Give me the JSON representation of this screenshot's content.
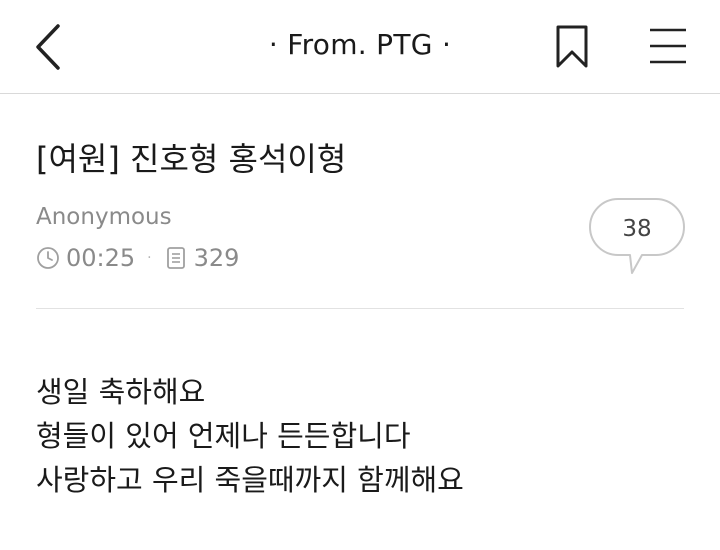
{
  "header": {
    "title": "· From. PTG ·",
    "back_icon": "chevron-left-icon",
    "bookmark_icon": "bookmark-icon",
    "menu_icon": "hamburger-menu-icon"
  },
  "post": {
    "title": "[여원] 진호형 홍석이형",
    "author": "Anonymous",
    "time": "00:25",
    "separator": "·",
    "views": "329",
    "comment_count": "38",
    "body": [
      "생일 축하해요",
      "형들이 있어 언제나 든든합니다",
      "사랑하고 우리 죽을때까지 함께해요"
    ]
  },
  "colors": {
    "text": "#1a1a1a",
    "muted": "#8a8a8a",
    "divider": "#e2e2e2"
  }
}
